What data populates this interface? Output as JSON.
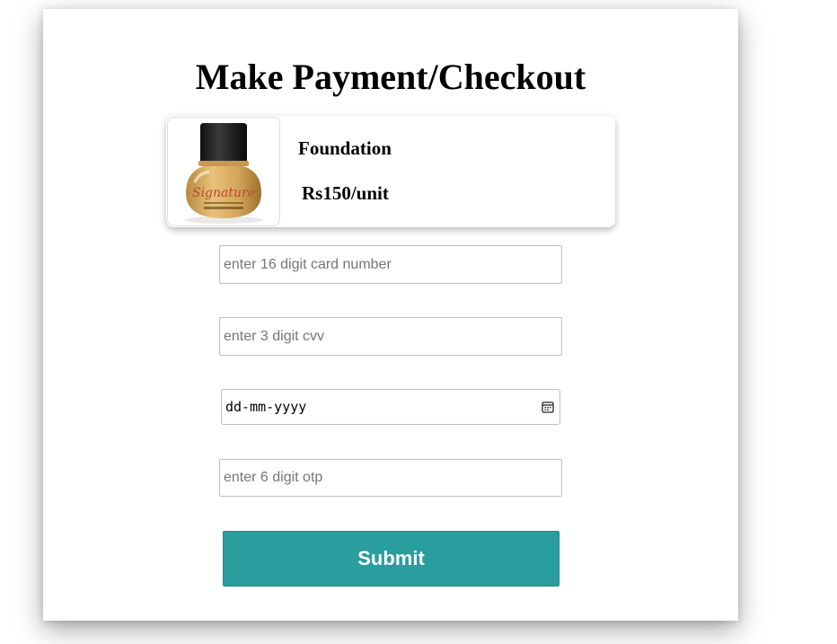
{
  "page": {
    "title": "Make Payment/Checkout"
  },
  "product": {
    "name": "Foundation",
    "price": "Rs150/unit",
    "image": "foundation-bottle-image",
    "image_label": "Signature"
  },
  "form": {
    "card_number": {
      "placeholder": "enter 16 digit card number",
      "value": ""
    },
    "cvv": {
      "placeholder": "enter 3 digit cvv",
      "value": ""
    },
    "date": {
      "placeholder": "dd-mm-yyyy",
      "icon": "calendar-icon"
    },
    "otp": {
      "placeholder": "enter 6 digit otp",
      "value": ""
    },
    "submit_label": "Submit"
  },
  "colors": {
    "submit_bg": "#2a9d9e",
    "submit_text": "#ffffff",
    "page_bg": "#ffffff"
  }
}
